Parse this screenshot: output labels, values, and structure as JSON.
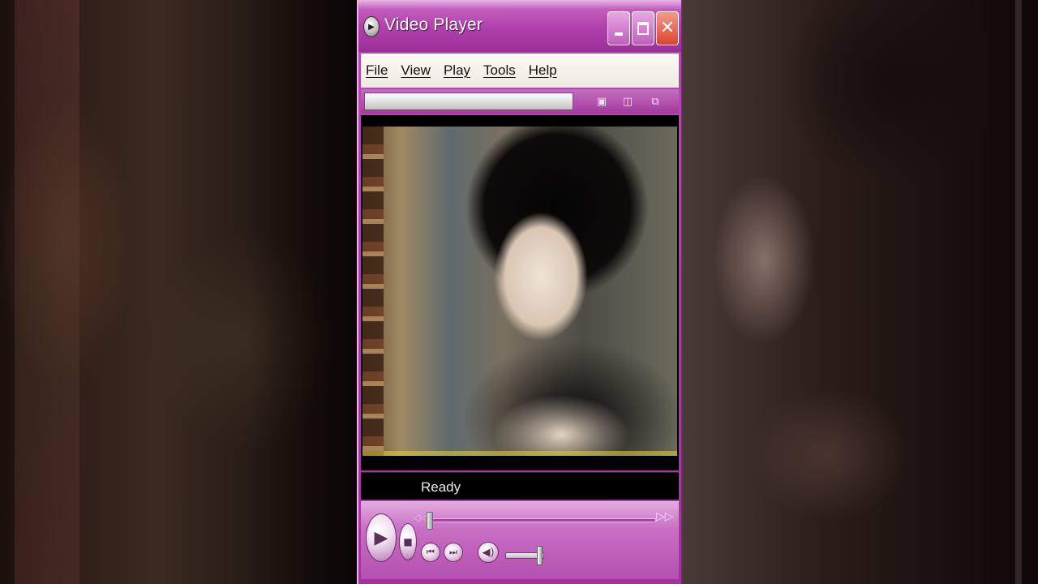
{
  "window": {
    "title": "Video Player",
    "icon": "media-player-icon",
    "buttons": {
      "minimize": "minimize-icon",
      "maximize": "maximize-icon",
      "close": "close-icon"
    }
  },
  "menu": {
    "items": [
      {
        "label": "File"
      },
      {
        "label": "View"
      },
      {
        "label": "Play"
      },
      {
        "label": "Tools"
      },
      {
        "label": "Help"
      }
    ]
  },
  "toolbar": {
    "icons": [
      "skin-mode-icon",
      "compact-mode-icon",
      "fullscreen-icon"
    ]
  },
  "status": {
    "text": "Ready"
  },
  "playback": {
    "seek_position_fraction": 0.0,
    "volume_fraction": 0.9,
    "icons": [
      "play-icon",
      "stop-icon",
      "previous-icon",
      "next-icon",
      "mute-icon",
      "rewind-icon",
      "fast-forward-icon"
    ]
  },
  "colors": {
    "frame_accent": "#b040ab",
    "menu_bar": "#f7f6ee",
    "close_button": "#d9452c"
  }
}
